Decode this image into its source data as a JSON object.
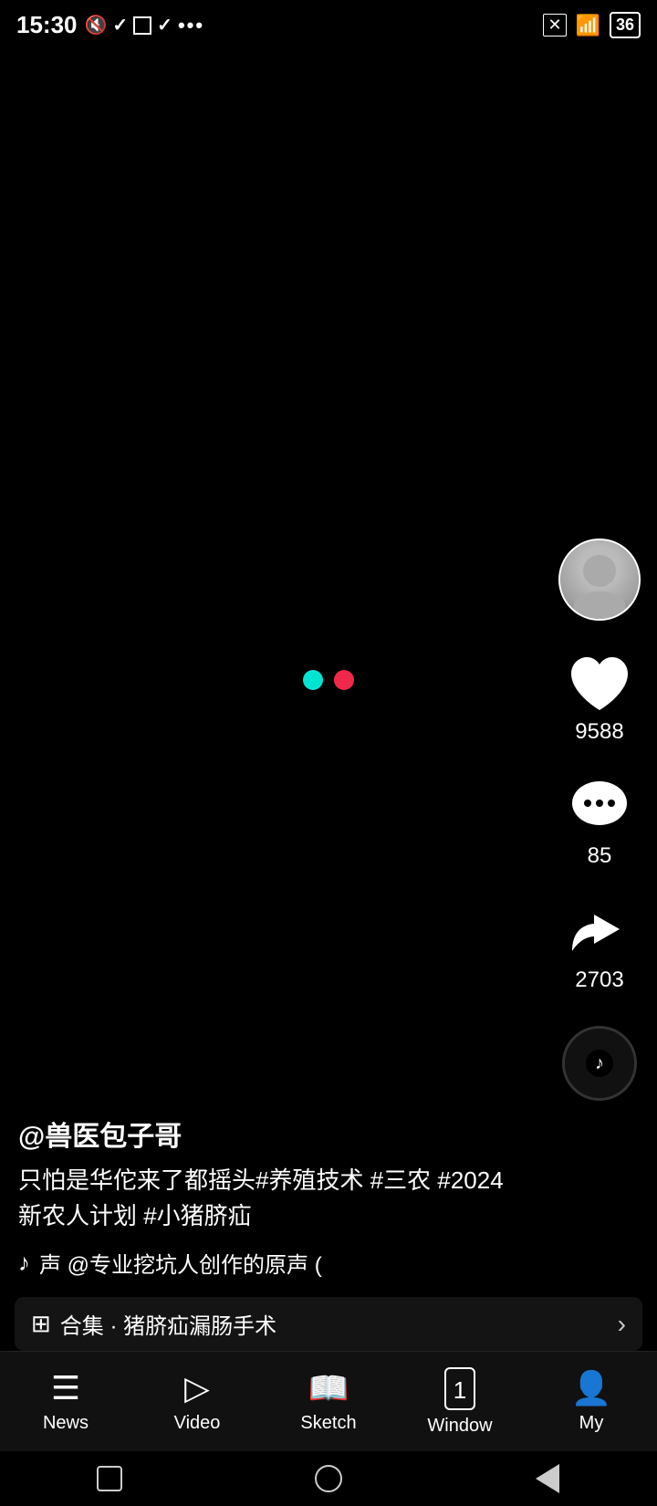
{
  "status": {
    "time": "15:30",
    "battery": "36"
  },
  "video": {
    "loading": true
  },
  "actions": {
    "likes": "9588",
    "comments": "85",
    "shares": "2703"
  },
  "content": {
    "username": "@兽医包子哥",
    "description": "只怕是华佗来了都摇头#养殖技术 #三农 #2024新农人计划 #小猪脐疝",
    "music_note": "♪",
    "music_text": "声   @专业挖坑人创作的原声   (",
    "collection_label": "合集 · 猪脐疝漏肠手术"
  },
  "nav": {
    "news": "News",
    "video": "Video",
    "sketch": "Sketch",
    "window": "Window",
    "window_count": "1",
    "my": "My"
  }
}
